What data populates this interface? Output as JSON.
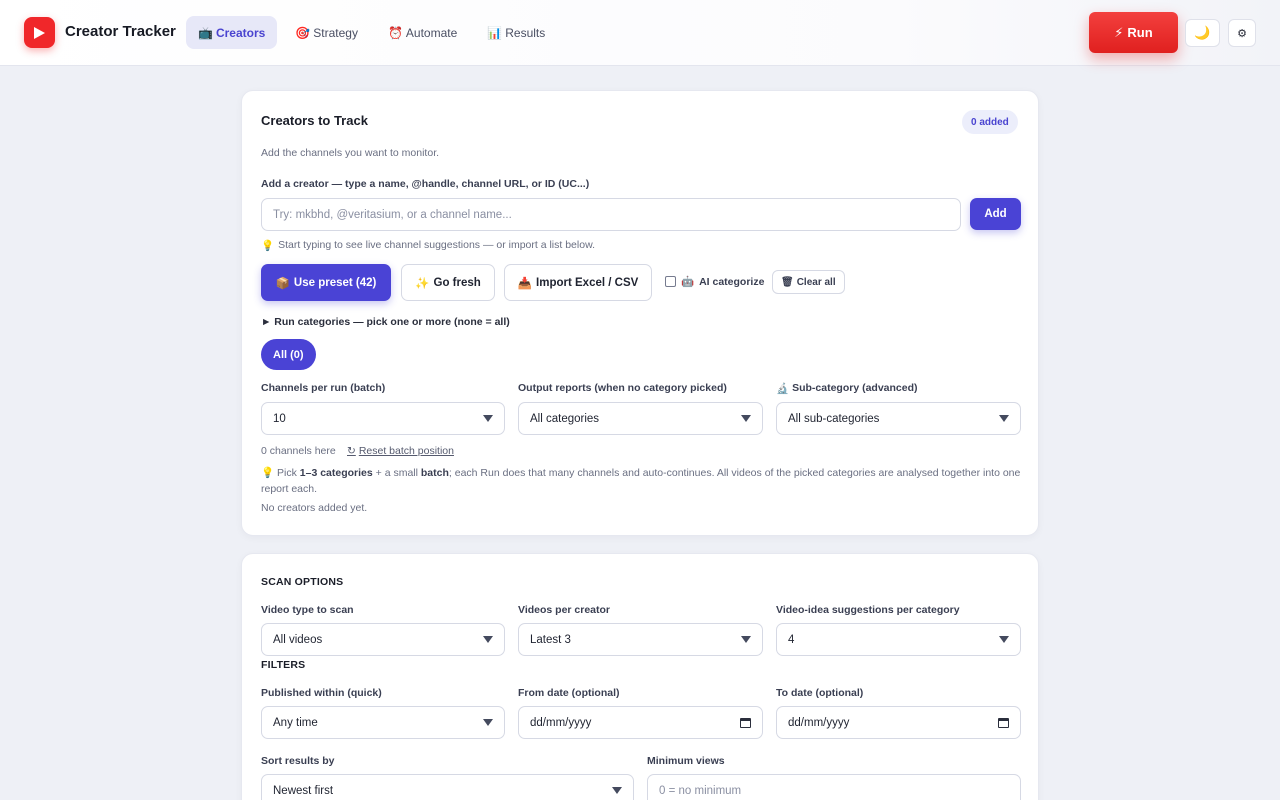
{
  "app": {
    "title": "Creator Tracker"
  },
  "nav": {
    "tabs": [
      {
        "icon": "📺",
        "label": "Creators",
        "active": true
      },
      {
        "icon": "🎯",
        "label": "Strategy"
      },
      {
        "icon": "⏰",
        "label": "Automate"
      },
      {
        "icon": "📊",
        "label": "Results"
      }
    ]
  },
  "header": {
    "run_icon": "⚡",
    "run_label": "Run",
    "theme_icon": "🌙",
    "settings_icon": "⚙"
  },
  "creators_card": {
    "title": "Creators to Track",
    "badge": "0 added",
    "subtitle": "Add the channels you want to monitor.",
    "add_label": "Add a creator — type a name, @handle, channel URL, or ID (UC...)",
    "input_placeholder": "Try: mkbhd, @veritasium, or a channel name...",
    "add_button": "Add",
    "hint_icon": "💡",
    "hint": "Start typing to see live channel suggestions — or import a list below.",
    "preset_icon": "📦",
    "preset_button": "Use preset (42)",
    "fresh_icon": "✨",
    "fresh_button": "Go fresh",
    "import_icon": "📥",
    "import_button": "Import Excel / CSV",
    "ai_icon": "🤖",
    "ai_categorize": "AI categorize",
    "clear_icon": "🗑",
    "clear_all": "Clear all",
    "categories_toggle": "► Run categories — pick one or more (none = all)",
    "all_pill": "All (0)",
    "batch_label": "Channels per run (batch)",
    "batch_value": "10",
    "output_label": "Output reports (when no category picked)",
    "output_value": "All categories",
    "subcat_icon": "🔬",
    "subcat_label": "Sub-category (advanced)",
    "subcat_value": "All sub-categories",
    "channels_here": "0 channels here",
    "reset_icon": "↻",
    "reset_link": "Reset batch position",
    "tip_pre": "Pick ",
    "tip_b1": "1–3 categories",
    "tip_mid": " + a small ",
    "tip_b2": "batch",
    "tip_post": "; each Run does that many channels and auto-continues. All videos of the picked categories are analysed together into one report each.",
    "empty": "No creators added yet."
  },
  "scan_card": {
    "scan_heading": "SCAN OPTIONS",
    "video_type_label": "Video type to scan",
    "video_type_value": "All videos",
    "videos_per_label": "Videos per creator",
    "videos_per_value": "Latest 3",
    "ideas_label": "Video-idea suggestions per category",
    "ideas_value": "4",
    "filters_heading": "FILTERS",
    "published_label": "Published within (quick)",
    "published_value": "Any time",
    "from_label": "From date (optional)",
    "from_value": "dd/mm/yyyy",
    "to_label": "To date (optional)",
    "to_value": "dd/mm/yyyy",
    "sort_label": "Sort results by",
    "sort_value": "Newest first",
    "minviews_label": "Minimum views",
    "minviews_placeholder": "0 = no minimum"
  }
}
